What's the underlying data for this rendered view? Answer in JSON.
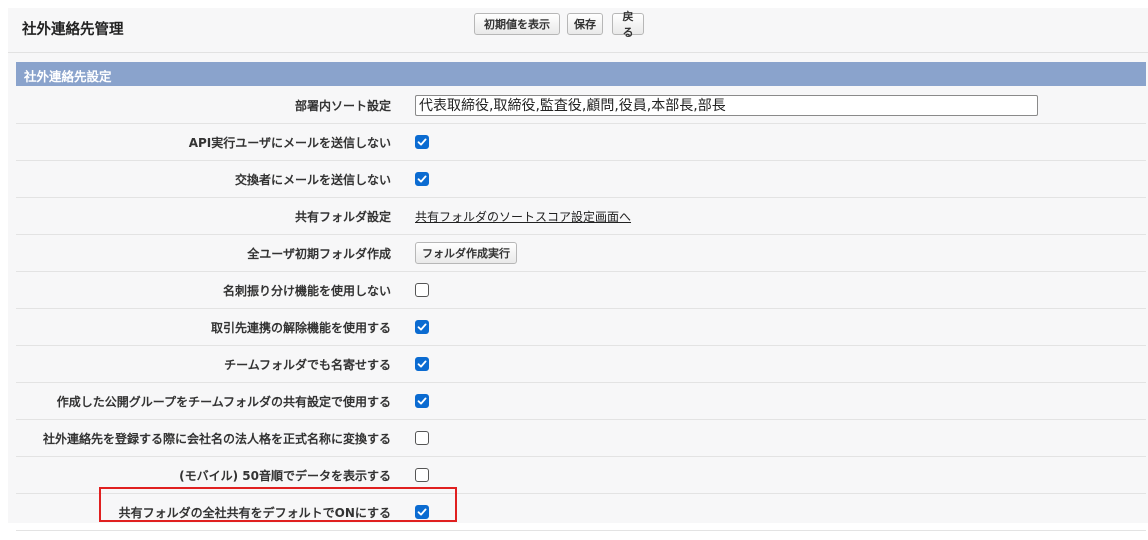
{
  "header": {
    "title": "社外連絡先管理",
    "buttons": {
      "defaults": "初期値を表示",
      "save": "保存",
      "back": "戻る"
    }
  },
  "section": {
    "title": "社外連絡先設定"
  },
  "rows": [
    {
      "label": "部署内ソート設定",
      "type": "text",
      "value": "代表取締役,取締役,監査役,顧問,役員,本部長,部長"
    },
    {
      "label": "API実行ユーザにメールを送信しない",
      "type": "checkbox",
      "checked": true
    },
    {
      "label": "交換者にメールを送信しない",
      "type": "checkbox",
      "checked": true
    },
    {
      "label": "共有フォルダ設定",
      "type": "link",
      "value": "共有フォルダのソートスコア設定画面へ"
    },
    {
      "label": "全ユーザ初期フォルダ作成",
      "type": "button",
      "value": "フォルダ作成実行"
    },
    {
      "label": "名刺振り分け機能を使用しない",
      "type": "checkbox",
      "checked": false
    },
    {
      "label": "取引先連携の解除機能を使用する",
      "type": "checkbox",
      "checked": true
    },
    {
      "label": "チームフォルダでも名寄せする",
      "type": "checkbox",
      "checked": true
    },
    {
      "label": "作成した公開グループをチームフォルダの共有設定で使用する",
      "type": "checkbox",
      "checked": true
    },
    {
      "label": "社外連絡先を登録する際に会社名の法人格を正式名称に変換する",
      "type": "checkbox",
      "checked": false
    },
    {
      "label": "(モバイル) 50音順でデータを表示する",
      "type": "checkbox",
      "checked": false
    },
    {
      "label": "共有フォルダの全社共有をデフォルトでONにする",
      "type": "checkbox",
      "checked": true,
      "highlighted": true
    }
  ],
  "colors": {
    "section_bar": "#8aa3cc",
    "checkbox_on": "#0b6bd1",
    "highlight": "#e02020"
  }
}
